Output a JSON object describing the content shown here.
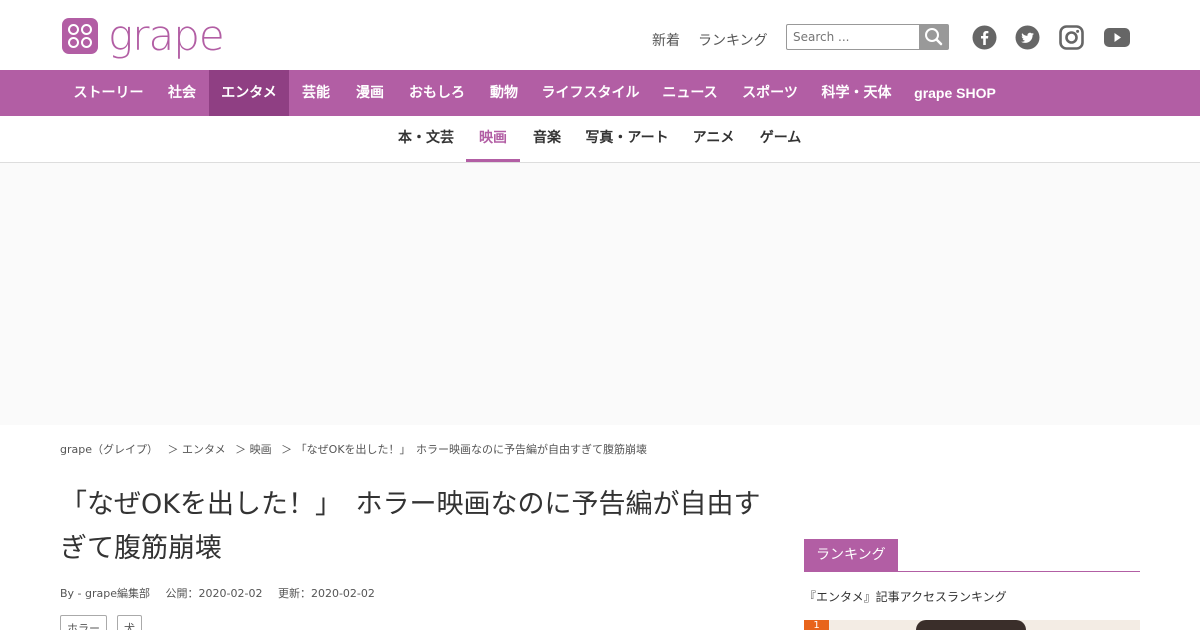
{
  "header": {
    "logo_text": "grape",
    "util_links": [
      "新着",
      "ランキング"
    ],
    "search": {
      "placeholder": "Search ..."
    },
    "social_icons": [
      "facebook-icon",
      "twitter-icon",
      "instagram-icon",
      "youtube-icon"
    ]
  },
  "main_nav": {
    "items": [
      "ストーリー",
      "社会",
      "エンタメ",
      "芸能",
      "漫画",
      "おもしろ",
      "動物",
      "ライフスタイル",
      "ニュース",
      "スポーツ",
      "科学・天体",
      "grape SHOP"
    ],
    "active": "エンタメ"
  },
  "sub_nav": {
    "items": [
      "本・文芸",
      "映画",
      "音楽",
      "写真・アート",
      "アニメ",
      "ゲーム"
    ],
    "active": "映画"
  },
  "breadcrumb": [
    "grape（グレイプ）",
    "＞ エンタメ",
    "＞ 映画",
    "＞ 「なぜOKを出した！」　ホラー映画なのに予告編が自由すぎて腹筋崩壊"
  ],
  "article": {
    "title": "「なぜOKを出した！」　ホラー映画なのに予告編が自由すぎて腹筋崩壊",
    "author": "By - grape編集部",
    "published": "公開：2020-02-02",
    "updated": "更新：2020-02-02",
    "tags": [
      "ホラー",
      "犬"
    ]
  },
  "sidebar": {
    "heading": "ランキング",
    "subheading": "『エンタメ』記事アクセスランキング",
    "first_rank": "1"
  },
  "colors": {
    "brand": "#b25ea4",
    "nav_active": "#8f3f83",
    "rank_badge": "#e8641b"
  }
}
